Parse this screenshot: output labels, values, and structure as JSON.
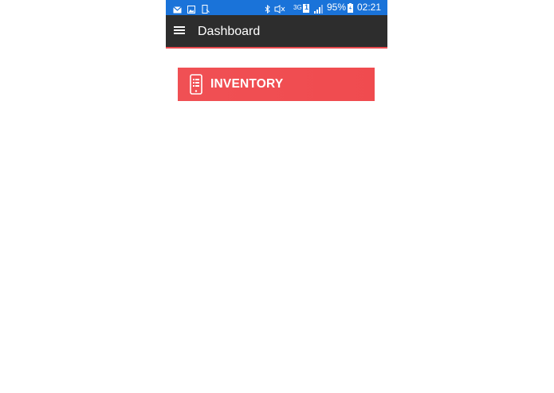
{
  "status_bar": {
    "battery": "95%",
    "time": "02:21",
    "network": "3G",
    "sim": "1"
  },
  "app_bar": {
    "title": "Dashboard",
    "background": "#2d2d2d",
    "accent": "#e84a4f"
  },
  "tiles": [
    {
      "label": "INVENTORY",
      "icon": "phone-list-icon",
      "color": "#f04e52"
    }
  ]
}
